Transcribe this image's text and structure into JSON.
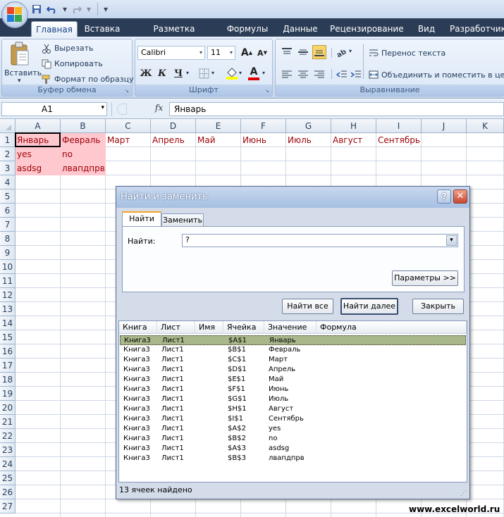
{
  "qat": {
    "icons": [
      "save-icon",
      "undo-icon",
      "redo-icon",
      "customize-icon"
    ]
  },
  "tabs": [
    {
      "label": "Главная",
      "active": true
    },
    {
      "label": "Вставка"
    },
    {
      "label": "Разметка страницы"
    },
    {
      "label": "Формулы"
    },
    {
      "label": "Данные"
    },
    {
      "label": "Рецензирование"
    },
    {
      "label": "Вид"
    },
    {
      "label": "Разработчик"
    }
  ],
  "ribbon": {
    "clipboard": {
      "paste": "Вставить",
      "cut": "Вырезать",
      "copy": "Копировать",
      "format_painter": "Формат по образцу",
      "label": "Буфер обмена"
    },
    "font": {
      "name": "Calibri",
      "size": "11",
      "bold": "Ж",
      "italic": "К",
      "underline": "Ч",
      "label": "Шрифт",
      "grow": "A",
      "shrink": "A",
      "font_color_letter": "A"
    },
    "alignment": {
      "wrap": "Перенос текста",
      "merge": "Объединить и поместить в цент",
      "label": "Выравнивание"
    }
  },
  "formula_bar": {
    "name_box": "A1",
    "fx": "fx",
    "value": "Январь"
  },
  "sheet": {
    "columns": [
      "A",
      "B",
      "C",
      "D",
      "E",
      "F",
      "G",
      "H",
      "I",
      "J",
      "K"
    ],
    "rows": [
      "1",
      "2",
      "3",
      "4",
      "5",
      "6",
      "7",
      "8",
      "9",
      "10",
      "11",
      "12",
      "13",
      "14",
      "15",
      "16",
      "17",
      "18",
      "19",
      "20",
      "21",
      "22",
      "23",
      "24",
      "25",
      "26",
      "27"
    ],
    "row1": [
      "Январь",
      "Февраль",
      "Март",
      "Апрель",
      "Май",
      "Июнь",
      "Июль",
      "Август",
      "Сентябрь"
    ],
    "row2": [
      "yes",
      "no"
    ],
    "row3": [
      "asdsg",
      "лвапдпрв"
    ]
  },
  "dialog": {
    "title": "Найти и заменить",
    "help": "?",
    "close": "✕",
    "tab_find": "Найти",
    "tab_replace": "Заменить",
    "find_label": "Найти:",
    "find_value": "?",
    "params_button": "Параметры >>",
    "find_all": "Найти все",
    "find_next": "Найти далее",
    "close_button": "Закрыть",
    "results_headers": [
      "Книга",
      "Лист",
      "Имя",
      "Ячейка",
      "Значение",
      "Формула"
    ],
    "results": [
      [
        "Книга3",
        "Лист1",
        "",
        "$A$1",
        "Январь",
        ""
      ],
      [
        "Книга3",
        "Лист1",
        "",
        "$B$1",
        "Февраль",
        ""
      ],
      [
        "Книга3",
        "Лист1",
        "",
        "$C$1",
        "Март",
        ""
      ],
      [
        "Книга3",
        "Лист1",
        "",
        "$D$1",
        "Апрель",
        ""
      ],
      [
        "Книга3",
        "Лист1",
        "",
        "$E$1",
        "Май",
        ""
      ],
      [
        "Книга3",
        "Лист1",
        "",
        "$F$1",
        "Июнь",
        ""
      ],
      [
        "Книга3",
        "Лист1",
        "",
        "$G$1",
        "Июль",
        ""
      ],
      [
        "Книга3",
        "Лист1",
        "",
        "$H$1",
        "Август",
        ""
      ],
      [
        "Книга3",
        "Лист1",
        "",
        "$I$1",
        "Сентябрь",
        ""
      ],
      [
        "Книга3",
        "Лист1",
        "",
        "$A$2",
        "yes",
        ""
      ],
      [
        "Книга3",
        "Лист1",
        "",
        "$B$2",
        "no",
        ""
      ],
      [
        "Книга3",
        "Лист1",
        "",
        "$A$3",
        "asdsg",
        ""
      ],
      [
        "Книга3",
        "Лист1",
        "",
        "$B$3",
        "лвапдпрв",
        ""
      ]
    ],
    "status": "13 ячеек найдено"
  },
  "watermark": "www.excelworld.ru",
  "colors": {
    "highlight_cell": "#ffc7ce",
    "highlight_text": "#9c0006",
    "selected_row": "#a9b88a",
    "tab_strip": "#2b3c57"
  }
}
